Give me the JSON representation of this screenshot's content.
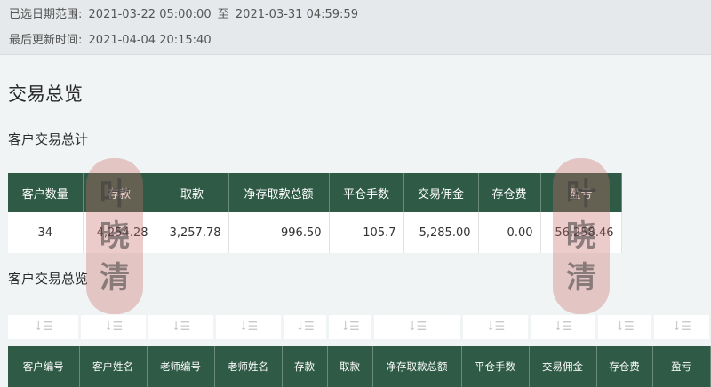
{
  "header": {
    "range_label": "已选日期范围:",
    "range_start": "2021-03-22 05:00:00",
    "range_sep": "至",
    "range_end": "2021-03-31 04:59:59",
    "updated_label": "最后更新时间:",
    "updated_value": "2021-04-04 20:15:40"
  },
  "page_title": "交易总览",
  "summary": {
    "title": "客户交易总计",
    "columns": [
      "客户数量",
      "存款",
      "取款",
      "净存取款总额",
      "平仓手数",
      "交易佣金",
      "存仓费",
      "盈亏"
    ],
    "row": [
      "34",
      "4,254.28",
      "3,257.78",
      "996.50",
      "105.7",
      "5,285.00",
      "0.00",
      "56,258.46"
    ]
  },
  "detail": {
    "title": "客户交易总览",
    "sort_icon_glyph": "↓☰",
    "columns": [
      "客户编号",
      "客户姓名",
      "老师编号",
      "老师姓名",
      "存款",
      "取款",
      "净存取款总额",
      "平仓手数",
      "交易佣金",
      "存仓费",
      "盈亏"
    ]
  },
  "watermark": {
    "chars": [
      "叶",
      "晓",
      "清"
    ]
  },
  "colors": {
    "header_green": "#2e5a46",
    "page_bg": "#f1f4f5",
    "stamp_red": "#c86e69"
  }
}
